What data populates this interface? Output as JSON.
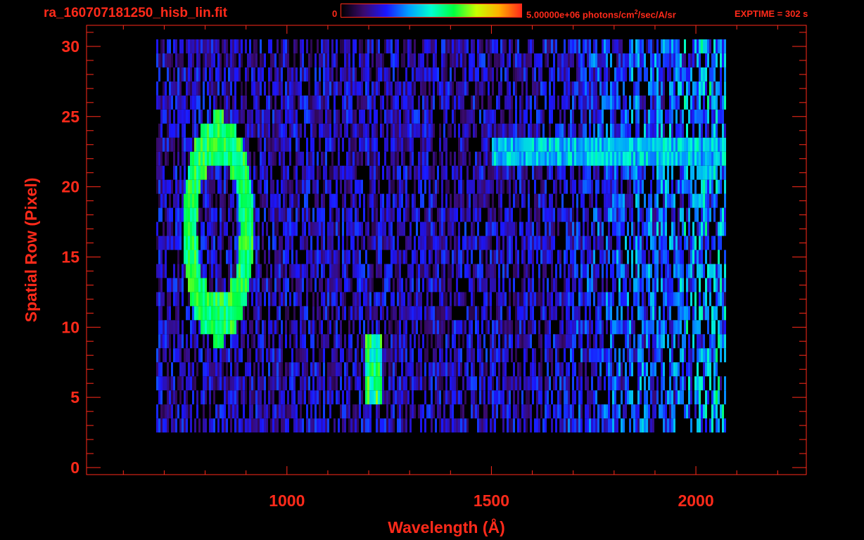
{
  "header": {
    "file_title": "ra_160707181250_hisb_lin.fit",
    "colorbar_min": "0",
    "colorbar_max_value": "5.00000e+06 photons/cm",
    "colorbar_max_exp": "2",
    "colorbar_max_units": "/sec/A/sr",
    "exptime": "EXPTIME = 302 s"
  },
  "colors": {
    "text": "#ff2a1a",
    "axes": "#ff2a1a",
    "background": "#000000",
    "colormap": [
      "#000000",
      "#3a0a6e",
      "#1a16ff",
      "#00a0ff",
      "#00ffd0",
      "#00ff40",
      "#c8ff00",
      "#ffb000",
      "#ff2a1a"
    ]
  },
  "chart_data": {
    "type": "heatmap",
    "title": "ra_160707181250_hisb_lin.fit",
    "xlabel": "Wavelength (Å)",
    "ylabel": "Spatial Row (Pixel)",
    "xlim": [
      510,
      2270
    ],
    "ylim": [
      -0.5,
      31.5
    ],
    "x_ticks": [
      1000,
      1500,
      2000
    ],
    "y_ticks": [
      0,
      5,
      10,
      15,
      20,
      25,
      30
    ],
    "x_minor_step": 100,
    "y_minor_step": 1,
    "data_range": {
      "x": [
        680,
        2070
      ],
      "y": [
        3,
        30
      ]
    },
    "colorbar": {
      "min": 0,
      "max": 5000000,
      "units": "photons/cm²/sec/A/sr"
    },
    "features": [
      {
        "name": "ring",
        "center_wavelength": 830,
        "center_row": 17,
        "radius_wavelength": 70,
        "radius_rows": 6.5,
        "level": 0.6
      },
      {
        "name": "bright_spot",
        "wavelength_range": [
          1190,
          1230
        ],
        "row_range": [
          5,
          9
        ],
        "level": 0.6
      },
      {
        "name": "band",
        "wavelength_range": [
          1500,
          2070
        ],
        "row_range": [
          22,
          23
        ],
        "level": 0.45
      }
    ],
    "exptime_s": 302
  }
}
